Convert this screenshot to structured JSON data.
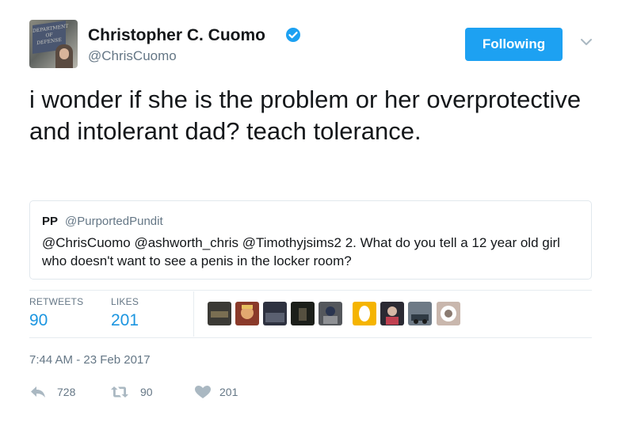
{
  "user": {
    "display_name": "Christopher C. Cuomo",
    "handle": "@ChrisCuomo",
    "avatar_sign_text": "DEPARTMENT OF DEFENSE",
    "verified": true
  },
  "follow_button_label": "Following",
  "tweet": {
    "text": "i wonder if she is the problem or her overprotective and intolerant dad? teach tolerance."
  },
  "quoted_tweet": {
    "name": "PP",
    "handle": "@PurportedPundit",
    "text": "@ChrisCuomo @ashworth_chris @Timothyjsims2 2. What do you tell a 12 year old girl who doesn't want to see a penis in the locker room?"
  },
  "stats": {
    "retweets_label": "RETWEETS",
    "retweets_value": "90",
    "likes_label": "LIKES",
    "likes_value": "201"
  },
  "likers": [
    {
      "name": "liker-1",
      "color": "#3b3a35"
    },
    {
      "name": "liker-2",
      "color": "#b5653a"
    },
    {
      "name": "liker-3",
      "color": "#2e3240"
    },
    {
      "name": "liker-4",
      "color": "#1c1f1a"
    },
    {
      "name": "liker-5",
      "color": "#54575c"
    },
    {
      "name": "liker-6",
      "color": "#f5b400"
    },
    {
      "name": "liker-7",
      "color": "#2b2a33"
    },
    {
      "name": "liker-8",
      "color": "#6e7a86"
    },
    {
      "name": "liker-9",
      "color": "#c9b7ad"
    }
  ],
  "timestamp": "7:44 AM - 23 Feb 2017",
  "actions": {
    "reply_count": "728",
    "retweet_count": "90",
    "like_count": "201"
  },
  "colors": {
    "accent": "#1da1f2",
    "link": "#1b95e0",
    "muted": "#657786",
    "text": "#14171a",
    "border": "#e1e8ed"
  }
}
